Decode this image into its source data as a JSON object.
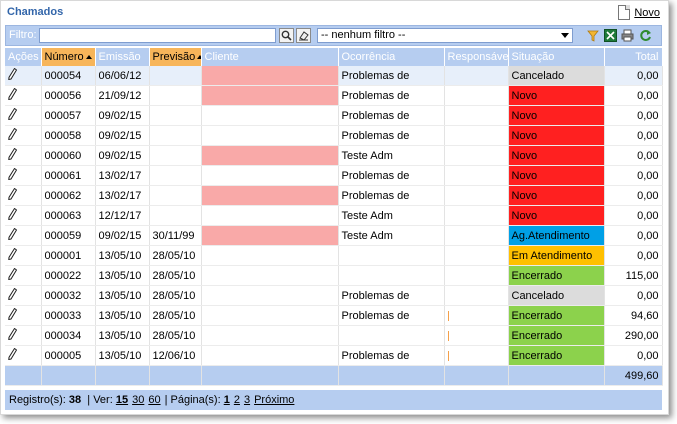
{
  "header": {
    "title": "Chamados",
    "new_label": "Novo"
  },
  "filter": {
    "label": "Filtro:",
    "value": "",
    "select_value": "-- nenhum filtro --"
  },
  "columns": {
    "acoes": "Ações",
    "numero": "Número",
    "emissao": "Emissão",
    "previsao": "Previsão",
    "cliente": "Cliente",
    "ocorrencia": "Ocorrência",
    "responsavel": "Responsável",
    "situacao": "Situação",
    "total": "Total"
  },
  "status_colors": {
    "Cancelado": "#dcdcdc",
    "Novo": "#ff2020",
    "Ag.Atendimento": "#00a0e6",
    "Em Atendimento": "#ffc000",
    "Encerrado": "#8cd24c"
  },
  "rows": [
    {
      "numero": "000054",
      "emissao": "06/06/12",
      "previsao": "",
      "cliente_hl": true,
      "ocorrencia": "Problemas de",
      "resp_mark": false,
      "situacao": "Cancelado",
      "total": "0,00"
    },
    {
      "numero": "000056",
      "emissao": "21/09/12",
      "previsao": "",
      "cliente_hl": true,
      "ocorrencia": "Problemas de",
      "resp_mark": false,
      "situacao": "Novo",
      "total": "0,00"
    },
    {
      "numero": "000057",
      "emissao": "09/02/15",
      "previsao": "",
      "cliente_hl": false,
      "ocorrencia": "Problemas de",
      "resp_mark": false,
      "situacao": "Novo",
      "total": "0,00"
    },
    {
      "numero": "000058",
      "emissao": "09/02/15",
      "previsao": "",
      "cliente_hl": false,
      "ocorrencia": "Problemas de",
      "resp_mark": false,
      "situacao": "Novo",
      "total": "0,00"
    },
    {
      "numero": "000060",
      "emissao": "09/02/15",
      "previsao": "",
      "cliente_hl": true,
      "ocorrencia": "Teste Adm",
      "resp_mark": false,
      "situacao": "Novo",
      "total": "0,00"
    },
    {
      "numero": "000061",
      "emissao": "13/02/17",
      "previsao": "",
      "cliente_hl": false,
      "ocorrencia": "Problemas de",
      "resp_mark": false,
      "situacao": "Novo",
      "total": "0,00"
    },
    {
      "numero": "000062",
      "emissao": "13/02/17",
      "previsao": "",
      "cliente_hl": true,
      "ocorrencia": "Problemas de",
      "resp_mark": false,
      "situacao": "Novo",
      "total": "0,00"
    },
    {
      "numero": "000063",
      "emissao": "12/12/17",
      "previsao": "",
      "cliente_hl": false,
      "ocorrencia": "Teste Adm",
      "resp_mark": false,
      "situacao": "Novo",
      "total": "0,00"
    },
    {
      "numero": "000059",
      "emissao": "09/02/15",
      "previsao": "30/11/99",
      "cliente_hl": true,
      "ocorrencia": "Teste Adm",
      "resp_mark": false,
      "situacao": "Ag.Atendimento",
      "total": "0,00"
    },
    {
      "numero": "000001",
      "emissao": "13/05/10",
      "previsao": "28/05/10",
      "cliente_hl": false,
      "ocorrencia": "",
      "resp_mark": false,
      "situacao": "Em Atendimento",
      "total": "0,00"
    },
    {
      "numero": "000022",
      "emissao": "13/05/10",
      "previsao": "28/05/10",
      "cliente_hl": false,
      "ocorrencia": "",
      "resp_mark": false,
      "situacao": "Encerrado",
      "total": "115,00"
    },
    {
      "numero": "000032",
      "emissao": "13/05/10",
      "previsao": "28/05/10",
      "cliente_hl": false,
      "ocorrencia": "Problemas de",
      "resp_mark": false,
      "situacao": "Cancelado",
      "total": "0,00"
    },
    {
      "numero": "000033",
      "emissao": "13/05/10",
      "previsao": "28/05/10",
      "cliente_hl": false,
      "ocorrencia": "Problemas de",
      "resp_mark": true,
      "situacao": "Encerrado",
      "total": "94,60"
    },
    {
      "numero": "000034",
      "emissao": "13/05/10",
      "previsao": "28/05/10",
      "cliente_hl": false,
      "ocorrencia": "",
      "resp_mark": true,
      "situacao": "Encerrado",
      "total": "290,00"
    },
    {
      "numero": "000005",
      "emissao": "13/05/10",
      "previsao": "12/06/10",
      "cliente_hl": false,
      "ocorrencia": "Problemas de",
      "resp_mark": true,
      "situacao": "Encerrado",
      "total": "0,00"
    }
  ],
  "footer": {
    "total": "499,60"
  },
  "pager": {
    "records_label": "Registro(s):",
    "records_count": "38",
    "ver_label": "| Ver:",
    "ver_options": [
      "15",
      "30",
      "60"
    ],
    "page_label": "| Página(s):",
    "pages": [
      "1",
      "2",
      "3"
    ],
    "next_label": "Próximo"
  }
}
